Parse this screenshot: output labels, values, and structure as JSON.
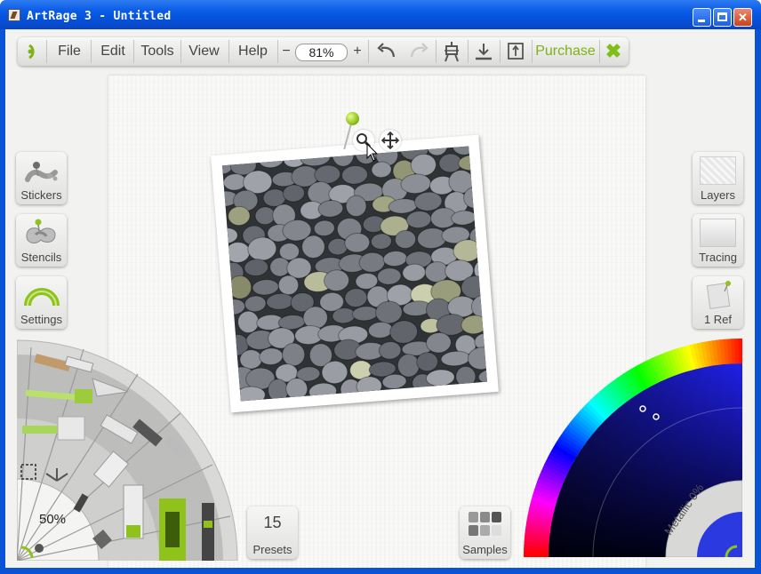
{
  "window": {
    "title": "ArtRage 3 - Untitled"
  },
  "toolbar": {
    "menus": [
      "File",
      "Edit",
      "Tools",
      "View",
      "Help"
    ],
    "zoom_minus": "−",
    "zoom_value": "81%",
    "zoom_plus": "+",
    "purchase": "Purchase"
  },
  "pods": {
    "stickers": "Stickers",
    "stencils": "Stencils",
    "settings": "Settings",
    "layers": "Layers",
    "tracing": "Tracing",
    "refs": "1 Ref",
    "presets_count": "15",
    "presets": "Presets",
    "samples": "Samples"
  },
  "tool_picker": {
    "brush_size": "50%"
  },
  "color_picker": {
    "metallic": "Metallic 0%",
    "selected_color": "#1f1fd8"
  },
  "colors": {
    "accent": "#8fc21b"
  }
}
